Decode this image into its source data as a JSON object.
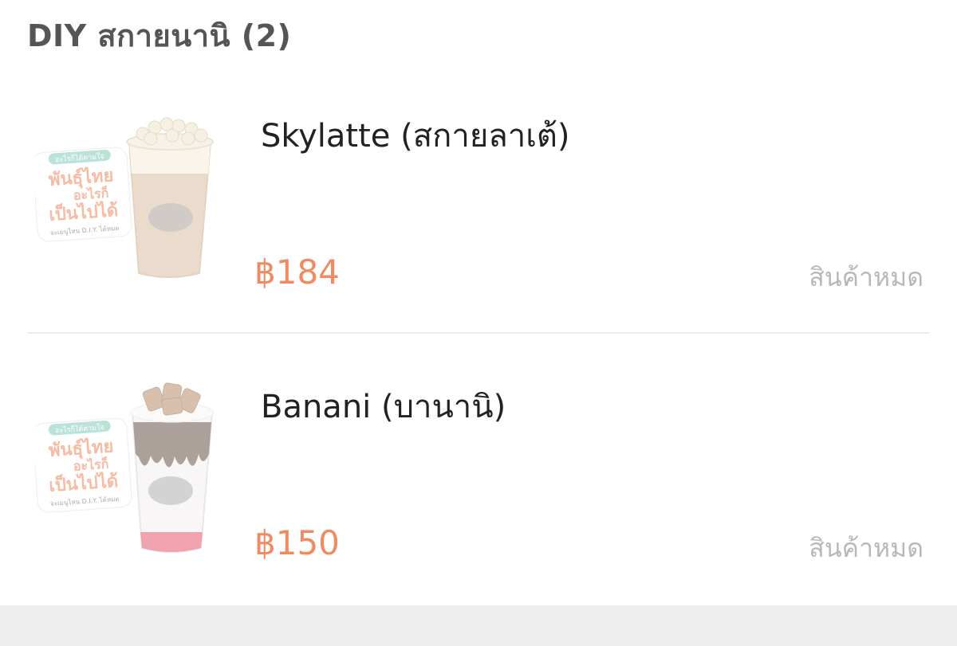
{
  "section": {
    "title": "DIY สกายนานิ (2)"
  },
  "items": [
    {
      "name": "Skylatte (สกายลาเต้)",
      "price": "฿184",
      "status": "สินค้าหมด",
      "image": {
        "icon": "iced-latte-with-cheese-balls",
        "badge_lines": [
          "อะไรก็ได้ตามใจ",
          "พันธุ์ไทย",
          "อะไรก็",
          "เป็นไปได้",
          "จะเมนูไหน D.I.Y. ได้หมด"
        ]
      }
    },
    {
      "name": "Banani (บานานิ)",
      "price": "฿150",
      "status": "สินค้าหมด",
      "image": {
        "icon": "iced-chocolate-banana-drink",
        "badge_lines": [
          "อะไรก็ได้ตามใจ",
          "พันธุ์ไทย",
          "อะไรก็",
          "เป็นไปได้",
          "จะเมนูไหน D.I.Y. ได้หมด"
        ]
      }
    }
  ],
  "colors": {
    "price": "#f08a63",
    "badge": "#f07a4a",
    "status": "#b8b8b8"
  }
}
